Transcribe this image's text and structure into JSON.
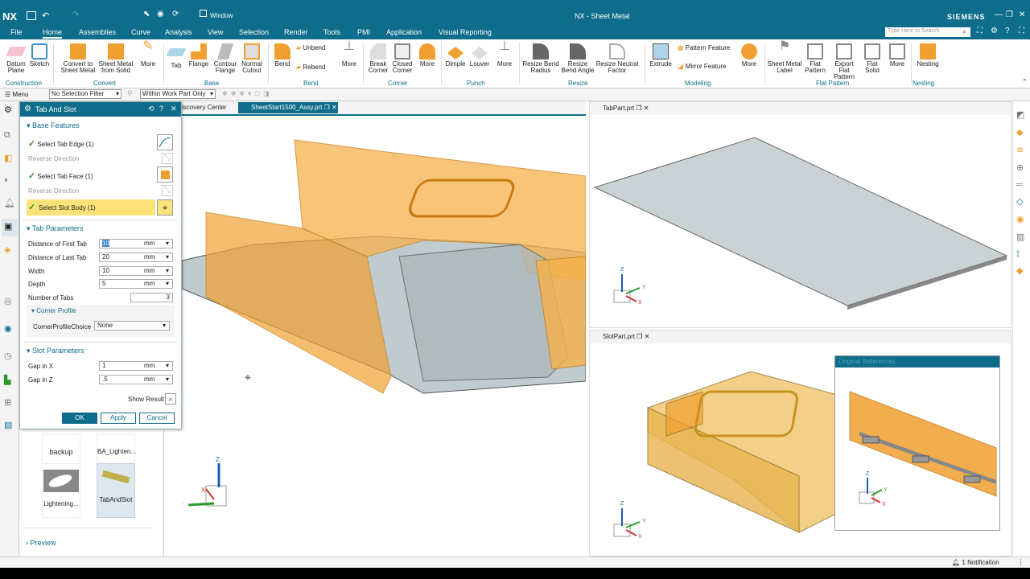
{
  "app": {
    "logo": "NX",
    "title": "NX - Sheet Metal",
    "brand": "SIEMENS",
    "window_label": "Window",
    "search_placeholder": "Type Here to Search"
  },
  "menu": [
    "File",
    "Home",
    "Assemblies",
    "Curve",
    "Analysis",
    "View",
    "Selection",
    "Render",
    "Tools",
    "PMI",
    "Application",
    "Visual Reporting"
  ],
  "ribbon": {
    "buttons": [
      {
        "label": "Datum Plane",
        "icon": "datum-plane-icon"
      },
      {
        "label": "Sketch",
        "icon": "sketch-icon"
      },
      {
        "label": "Convert to Sheet Metal",
        "icon": "convert-icon"
      },
      {
        "label": "Sheet Metal from Solid",
        "icon": "sm-from-solid-icon"
      },
      {
        "label": "More",
        "icon": "more-icon"
      },
      {
        "label": "Tab",
        "icon": "tab-icon"
      },
      {
        "label": "Flange",
        "icon": "flange-icon"
      },
      {
        "label": "Contour Flange",
        "icon": "contour-flange-icon"
      },
      {
        "label": "Normal Cutout",
        "icon": "normal-cutout-icon"
      },
      {
        "label": "Bend",
        "icon": "bend-icon"
      },
      {
        "label": "Unbend",
        "icon": "unbend-icon"
      },
      {
        "label": "Rebend",
        "icon": "rebend-icon"
      },
      {
        "label": "More",
        "icon": "more-icon"
      },
      {
        "label": "Break Corner",
        "icon": "break-corner-icon"
      },
      {
        "label": "Closed Corner",
        "icon": "closed-corner-icon"
      },
      {
        "label": "More",
        "icon": "more-icon"
      },
      {
        "label": "Dimple",
        "icon": "dimple-icon"
      },
      {
        "label": "Louver",
        "icon": "louver-icon"
      },
      {
        "label": "More",
        "icon": "more-icon"
      },
      {
        "label": "Resize Bend Radius",
        "icon": "resize-bend-radius-icon"
      },
      {
        "label": "Resize Bend Angle",
        "icon": "resize-bend-angle-icon"
      },
      {
        "label": "Resize Neutral Factor",
        "icon": "resize-neutral-factor-icon"
      },
      {
        "label": "Extrude",
        "icon": "extrude-icon"
      },
      {
        "label": "Pattern Feature",
        "icon": "pattern-feature-icon"
      },
      {
        "label": "Mirror Feature",
        "icon": "mirror-feature-icon"
      },
      {
        "label": "More",
        "icon": "more-icon"
      },
      {
        "label": "Sheet Metal Label",
        "icon": "sm-label-icon"
      },
      {
        "label": "Flat Pattern",
        "icon": "flat-pattern-icon"
      },
      {
        "label": "Export Flat Pattern",
        "icon": "export-flat-pattern-icon"
      },
      {
        "label": "Flat Solid",
        "icon": "flat-solid-icon"
      },
      {
        "label": "More",
        "icon": "more-icon"
      },
      {
        "label": "Nesting",
        "icon": "nesting-icon"
      }
    ],
    "groups": [
      "Construction",
      "Convert",
      "Base",
      "Bend",
      "Corner",
      "Punch",
      "Resize",
      "Modeling",
      "Flat Pattern",
      "Nesting"
    ]
  },
  "selbar": {
    "menu": "Menu",
    "filter": "No Selection Filter",
    "scope": "Within Work Part Only"
  },
  "dialog": {
    "title": "Tab And Slot",
    "base_features": "Base Features",
    "select_tab_edge": "Select Tab Edge (1)",
    "reverse_direction": "Reverse Direction",
    "select_tab_face": "Select Tab Face (1)",
    "reverse_direction2": "Reverse Direction",
    "select_slot_body": "Select Slot Body (1)",
    "tab_parameters": "Tab Parameters",
    "params": [
      {
        "label": "Distance of First Tab",
        "value": "10",
        "unit": "mm"
      },
      {
        "label": "Distance of Last Tab",
        "value": "20",
        "unit": "mm"
      },
      {
        "label": "Width",
        "value": "10",
        "unit": "mm"
      },
      {
        "label": "Depth",
        "value": "5",
        "unit": "mm"
      }
    ],
    "number_of_tabs_label": "Number of Tabs",
    "number_of_tabs": "3",
    "corner_profile": "Corner Profile",
    "corner_profile_choice_label": "CornerProfileChoice",
    "corner_profile_choice": "None",
    "slot_parameters": "Slot Parameters",
    "slot_params": [
      {
        "label": "Gap in X",
        "value": "1",
        "unit": "mm"
      },
      {
        "label": "Gap in Z",
        "value": ".5",
        "unit": "mm"
      }
    ],
    "show_result": "Show Result",
    "ok": "OK",
    "apply": "Apply",
    "cancel": "Cancel"
  },
  "library": {
    "items": [
      "backup",
      "BA_Lighten...",
      "Lightening...",
      "TabAndSlot"
    ],
    "preview": "Preview"
  },
  "tabs": {
    "discovery": "iscovery Center",
    "assy": "SheetStart1500_Assy.prt",
    "tabpart": "TabPart.prt",
    "slotpart": "SlotPart.prt"
  },
  "views": {
    "orig_refs": "Original References",
    "axis_x": "X",
    "axis_y": "Y",
    "axis_z": "Z"
  },
  "status": {
    "notification": "1 Notification"
  },
  "colors": {
    "accent": "#0e6d8a",
    "orange": "#f0a030",
    "plate": "#c9d3d6"
  }
}
